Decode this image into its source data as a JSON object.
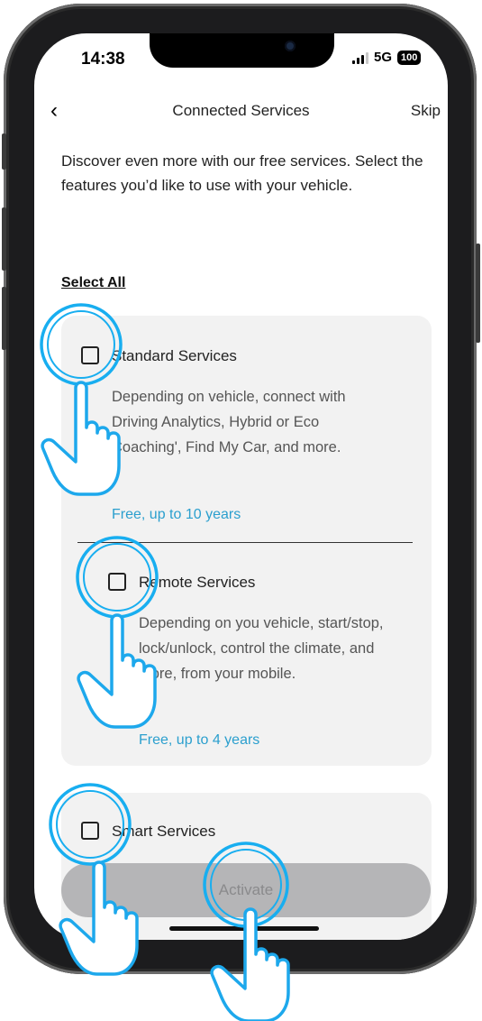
{
  "status_bar": {
    "time": "14:38",
    "network": "5G",
    "battery": "100"
  },
  "nav": {
    "back_icon": "chevron-left-icon",
    "back_glyph": "‹",
    "title": "Connected Services",
    "skip_label": "Skip"
  },
  "intro": {
    "text": "Discover even more with our free services. Select the features you’d like to use with your vehicle."
  },
  "select_all_label": "Select All",
  "services": [
    {
      "title": "Standard Services",
      "description": "Depending on vehicle, connect with Driving Analytics, Hybrid or Eco Coaching', Find My Car, and more.",
      "price": "Free, up to 10 years",
      "checked": false
    },
    {
      "title": "Remote Services",
      "description": "Depending on you vehicle, start/stop, lock/unlock, control the climate, and more, from your mobile.",
      "price": "Free, up to 4 years",
      "checked": false
    },
    {
      "title": "Smart Services",
      "checked": false
    }
  ],
  "activate_label": "Activate",
  "colors": {
    "accent": "#2b9fce",
    "highlight_ring": "#18aef0",
    "card_bg": "#f2f2f2",
    "button_disabled": "#b5b5b7"
  }
}
